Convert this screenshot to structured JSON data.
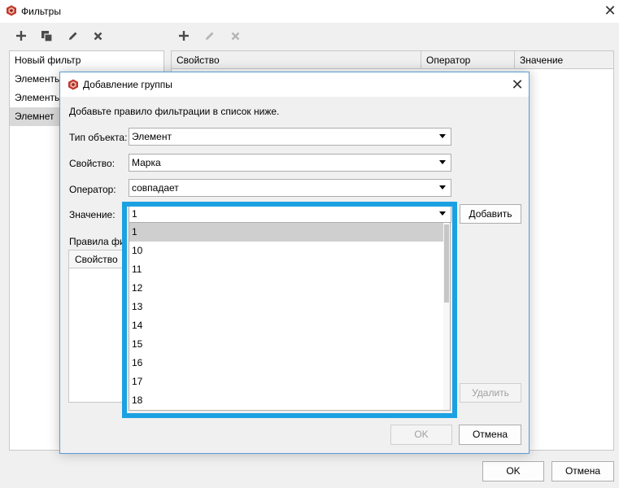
{
  "window": {
    "title": "Фильтры",
    "close_glyph": "✕",
    "icon": "app-logo-icon"
  },
  "left_toolbar": {
    "icons": [
      "add-icon",
      "copy-icon",
      "edit-icon",
      "delete-icon"
    ]
  },
  "right_toolbar": {
    "icons": [
      "add-icon",
      "edit-icon",
      "delete-icon"
    ]
  },
  "filters": [
    {
      "label": "Новый фильтр",
      "selected": false
    },
    {
      "label": "Элементы",
      "selected": false
    },
    {
      "label": "Элементы",
      "selected": false
    },
    {
      "label": "Элемнет",
      "selected": true
    }
  ],
  "rules_table": {
    "columns": [
      "Свойство",
      "Оператор",
      "Значение"
    ]
  },
  "footer": {
    "ok_label": "OK",
    "cancel_label": "Отмена"
  },
  "dialog": {
    "title": "Добавление группы",
    "close_glyph": "✕",
    "instruction": "Добавьте правило фильтрации в список ниже.",
    "fields": {
      "object_type": {
        "label": "Тип объекта:",
        "value": "Элемент"
      },
      "property": {
        "label": "Свойство:",
        "value": "Марка"
      },
      "operator": {
        "label": "Оператор:",
        "value": "совпадает"
      },
      "value": {
        "label": "Значение:",
        "value": "1"
      }
    },
    "add_label": "Добавить",
    "rules_label": "Правила фи",
    "rules_column": "Свойство",
    "remove_label": "Удалить",
    "ok_label": "OK",
    "cancel_label": "Отмена",
    "dropdown_options": [
      "1",
      "10",
      "11",
      "12",
      "13",
      "14",
      "15",
      "16",
      "17",
      "18"
    ],
    "dropdown_highlighted": "1",
    "highlight_color": "#1ba1e2"
  }
}
